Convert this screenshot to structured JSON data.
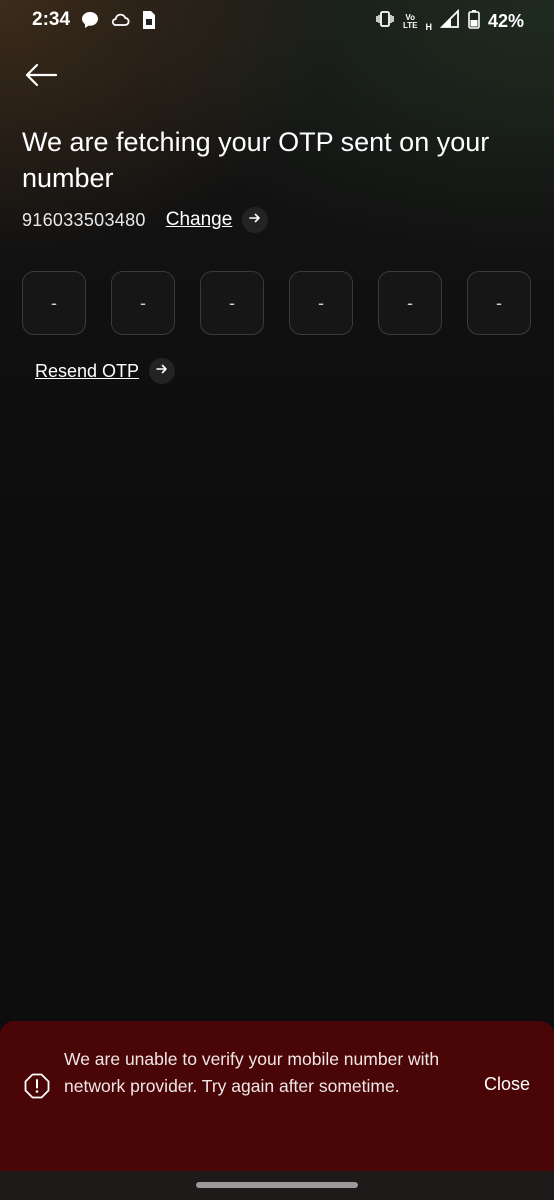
{
  "status_bar": {
    "time": "2:34",
    "lte_top": "Vo",
    "lte_bottom": "LTE",
    "signal_label": "H",
    "battery": "42%"
  },
  "header": {
    "title": "We are fetching your OTP sent on your number"
  },
  "phone": {
    "number": "916033503480",
    "change_label": "Change"
  },
  "otp": {
    "digits": [
      "-",
      "-",
      "-",
      "-",
      "-",
      "-"
    ]
  },
  "resend": {
    "label": "Resend OTP"
  },
  "toast": {
    "message": "We are unable to verify your mobile number with network provider. Try again after sometime.",
    "close_label": "Close"
  },
  "colors": {
    "background": "#0d0d0d",
    "toast_background": "#4a0606",
    "otp_box_border": "#3a3a3a",
    "arrow_circle": "#232323"
  },
  "icons": {
    "back": "back-arrow-icon",
    "arrow": "arrow-right-icon",
    "toast": "alert-octagon-icon"
  }
}
